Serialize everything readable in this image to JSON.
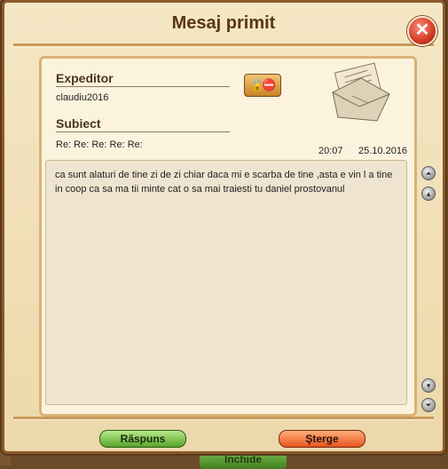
{
  "background": {
    "close_label": "Inchide"
  },
  "window": {
    "title": "Mesaj primit",
    "close_glyph": "✕"
  },
  "header": {
    "sender_label": "Expeditor",
    "sender_value": "claudiu2016",
    "subject_label": "Subiect",
    "subject_value": "Re: Re: Re: Re: Re:",
    "time": "20:07",
    "date": "25.10.2016"
  },
  "message": {
    "body": "ca sunt alaturi de tine zi de zi chiar daca mi e scarba de tine ,asta e vin l a tine in coop ca sa ma tii minte cat o sa mai traiesti tu daniel prostovanul"
  },
  "footer": {
    "reply_label": "Răspuns",
    "delete_label": "Şterge"
  },
  "icons": {
    "contact": "lock-and-block-icon",
    "envelope": "envelope-letter-icon",
    "scroll": [
      "scroll-top-icon",
      "scroll-up-icon",
      "scroll-down-icon",
      "scroll-bottom-icon"
    ]
  }
}
